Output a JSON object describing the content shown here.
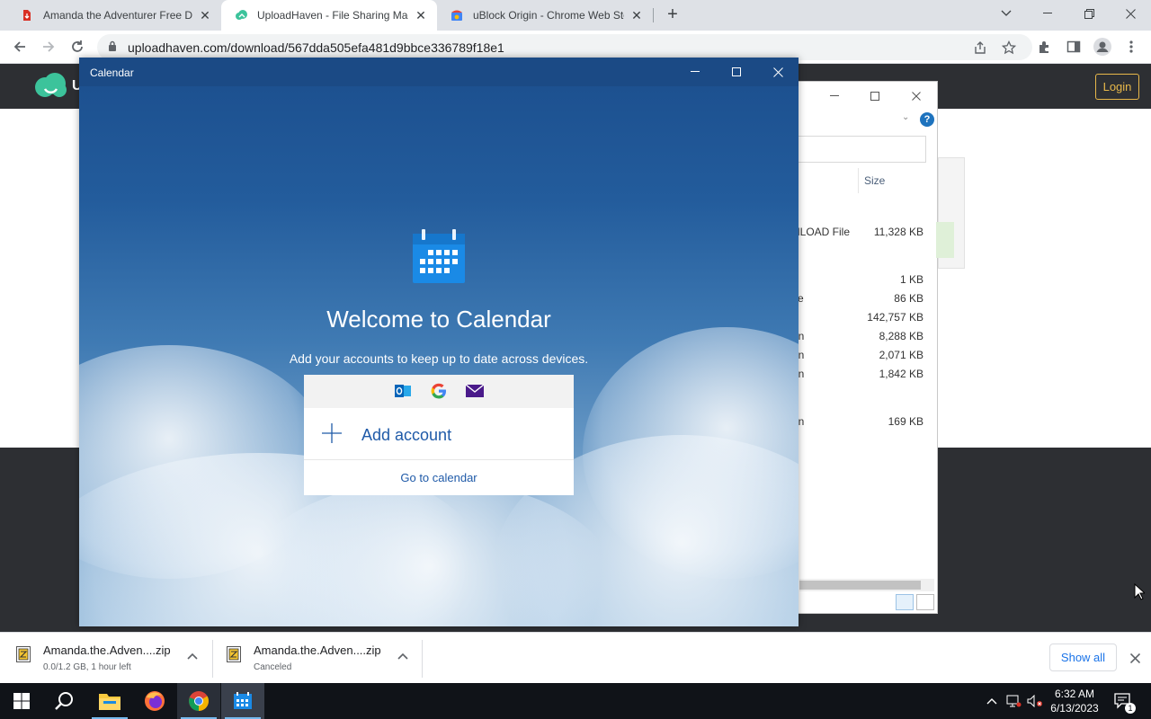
{
  "browser": {
    "tabs": [
      {
        "title": "Amanda the Adventurer Free Do",
        "favicon": "red-download-icon",
        "active": false
      },
      {
        "title": "UploadHaven - File Sharing Mad",
        "favicon": "uploadhaven-cloud-icon",
        "active": true
      },
      {
        "title": "uBlock Origin - Chrome Web Sto",
        "favicon": "chrome-webstore-icon",
        "active": false
      }
    ],
    "url": "uploadhaven.com/download/567dda505efa481d9bbce336789f18e1"
  },
  "site": {
    "logo_letter": "U",
    "login_label": "Login",
    "colors": {
      "header": "#2d2f33",
      "login_accent": "#e8b84a"
    }
  },
  "explorer": {
    "column_size": "Size",
    "rows": [
      {
        "name": "NLOAD File",
        "size": "11,328 KB"
      },
      {
        "name": "",
        "size": "1 KB"
      },
      {
        "name": "ve",
        "size": "86 KB"
      },
      {
        "name": "e",
        "size": "142,757 KB"
      },
      {
        "name": "on",
        "size": "8,288 KB"
      },
      {
        "name": "on",
        "size": "2,071 KB"
      },
      {
        "name": "on",
        "size": "1,842 KB"
      },
      {
        "name": "on",
        "size": "169 KB"
      }
    ]
  },
  "calendar": {
    "window_title": "Calendar",
    "welcome": "Welcome to Calendar",
    "subtitle": "Add your accounts to keep up to date across devices.",
    "add_account": "Add account",
    "go_to_calendar": "Go to calendar",
    "account_icons": [
      "outlook-icon",
      "google-icon",
      "mail-icon"
    ]
  },
  "downloads": {
    "items": [
      {
        "name": "Amanda.the.Adven....zip",
        "status": "0.0/1.2 GB, 1 hour left"
      },
      {
        "name": "Amanda.the.Adven....zip",
        "status": "Canceled"
      }
    ],
    "show_all": "Show all"
  },
  "taskbar": {
    "time": "6:32 AM",
    "date": "6/13/2023",
    "notification_count": "1"
  }
}
